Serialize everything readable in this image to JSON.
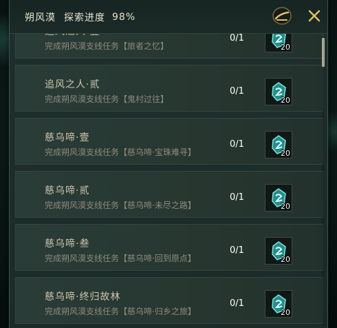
{
  "header": {
    "name": "朔风漠",
    "label": "探索进度",
    "percent": "98%"
  },
  "icons": {
    "scroll_tool": "scroll-tool-icon",
    "close": "close-icon",
    "reward": "jade-token-icon"
  },
  "colors": {
    "accent": "#e6c067",
    "title_text": "#cfc6ae",
    "desc_text": "#8e8a7d",
    "reward_icon": "#2ab5b0"
  },
  "quests": [
    {
      "title": "追风之人·壹",
      "desc": "完成朔风漠支线任务【旅者之忆】",
      "count": "0/1",
      "reward_qty": "20"
    },
    {
      "title": "追风之人·贰",
      "desc": "完成朔风漠支线任务【鬼村过往】",
      "count": "0/1",
      "reward_qty": "20"
    },
    {
      "title": "慈乌啼·壹",
      "desc": "完成朔风漠支线任务【慈乌啼·宝珠难寻】",
      "count": "0/1",
      "reward_qty": "20"
    },
    {
      "title": "慈乌啼·贰",
      "desc": "完成朔风漠支线任务【慈乌啼·未尽之路】",
      "count": "0/1",
      "reward_qty": "20"
    },
    {
      "title": "慈乌啼·叁",
      "desc": "完成朔风漠支线任务【慈乌啼·回到原点】",
      "count": "0/1",
      "reward_qty": "20"
    },
    {
      "title": "慈乌啼·终归故林",
      "desc": "完成朔风漠支线任务【慈乌啼·归乡之旅】",
      "count": "0/1",
      "reward_qty": "20"
    }
  ]
}
